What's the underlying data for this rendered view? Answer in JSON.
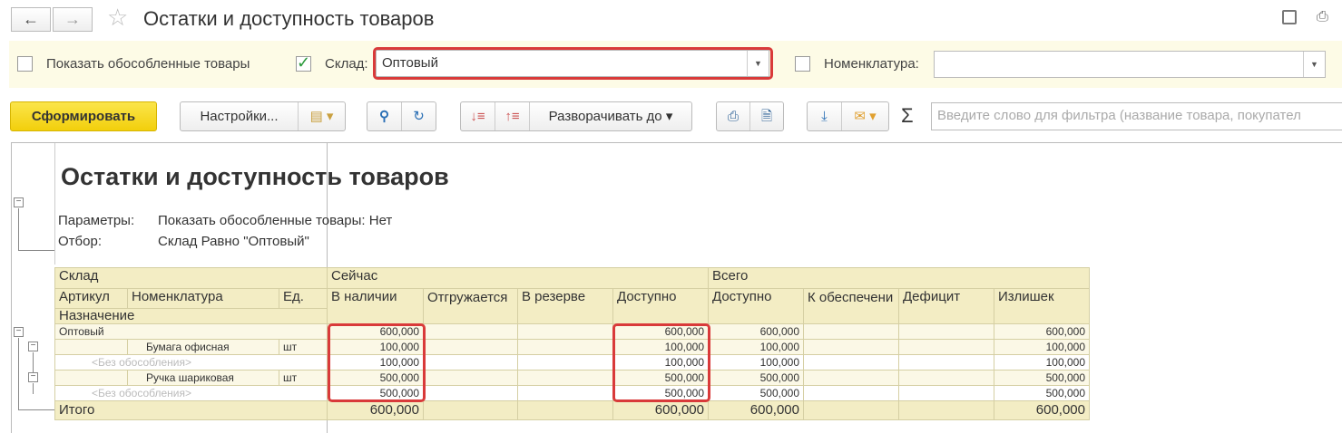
{
  "header": {
    "title": "Остатки и доступность товаров",
    "back": "←",
    "forward": "→"
  },
  "filters": {
    "show_isolated_label": "Показать обособленные товары",
    "warehouse_label": "Склад:",
    "warehouse_value": "Оптовый",
    "nomenclature_label": "Номенклатура:",
    "nomenclature_value": ""
  },
  "toolbar": {
    "generate": "Сформировать",
    "settings": "Настройки...",
    "expand_to": "Разворачивать до",
    "filter_placeholder": "Введите слово для фильтра (название товара, покупател"
  },
  "report": {
    "title": "Остатки и доступность товаров",
    "params_label": "Параметры:",
    "params_value": "Показать обособленные товары: Нет",
    "filter_label": "Отбор:",
    "filter_value": "Склад Равно \"Оптовый\"",
    "headers": {
      "sklad": "Склад",
      "now": "Сейчас",
      "total": "Всего",
      "artikul": "Артикул",
      "nomenklatura": "Номенклатура",
      "ed": "Ед.",
      "in_stock": "В наличии",
      "shipping": "Отгружается",
      "reserved": "В резерве",
      "available": "Доступно",
      "total_available": "Доступно",
      "to_provide": "К обеспечени",
      "deficit": "Дефицит",
      "surplus": "Излишек",
      "purpose": "Назначение"
    },
    "rows": [
      {
        "name": "Оптовый",
        "unit": "",
        "in_stock": "600,000",
        "available": "600,000",
        "total_available": "600,000",
        "surplus": "600,000"
      },
      {
        "name": "Бумага офисная",
        "unit": "шт",
        "in_stock": "100,000",
        "available": "100,000",
        "total_available": "100,000",
        "surplus": "100,000"
      },
      {
        "name": "<Без обособления>",
        "unit": "",
        "in_stock": "100,000",
        "available": "100,000",
        "total_available": "100,000",
        "surplus": "100,000"
      },
      {
        "name": "Ручка шариковая",
        "unit": "шт",
        "in_stock": "500,000",
        "available": "500,000",
        "total_available": "500,000",
        "surplus": "500,000"
      },
      {
        "name": "<Без обособления>",
        "unit": "",
        "in_stock": "500,000",
        "available": "500,000",
        "total_available": "500,000",
        "surplus": "500,000"
      }
    ],
    "total": {
      "label": "Итого",
      "in_stock": "600,000",
      "available": "600,000",
      "total_available": "600,000",
      "surplus": "600,000"
    }
  }
}
